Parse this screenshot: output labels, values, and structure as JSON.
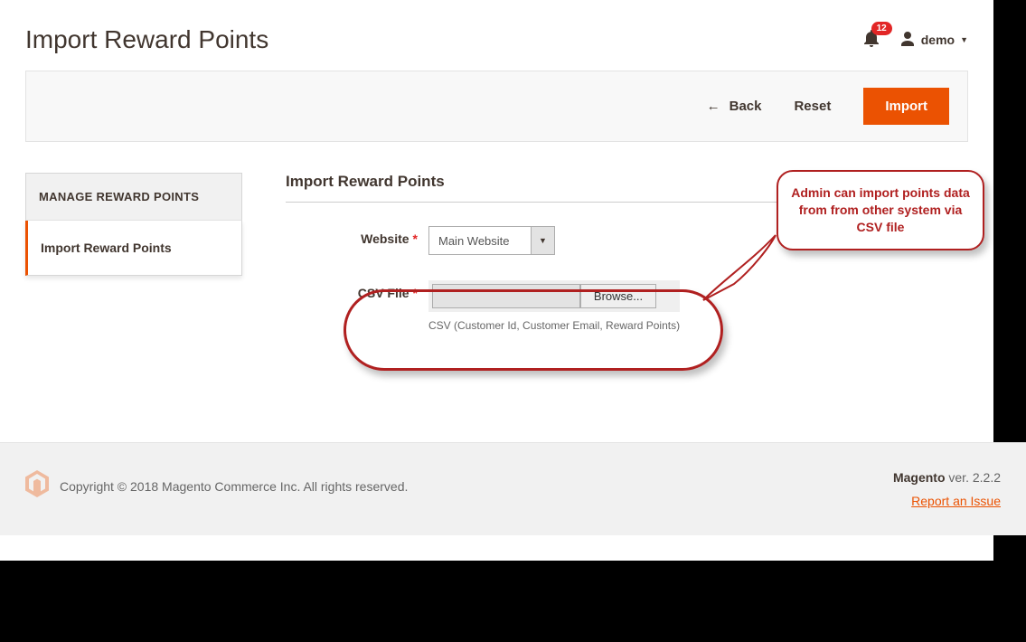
{
  "header": {
    "title": "Import Reward Points",
    "notification_count": "12",
    "username": "demo"
  },
  "toolbar": {
    "back_label": "Back",
    "reset_label": "Reset",
    "import_label": "Import"
  },
  "sidebar": {
    "heading": "MANAGE REWARD POINTS",
    "active_item": "Import Reward Points"
  },
  "form": {
    "section_title": "Import Reward Points",
    "website_label": "Website",
    "website_value": "Main Website",
    "csv_label": "CSV File",
    "browse_label": "Browse...",
    "csv_hint": "CSV (Customer Id, Customer Email, Reward Points)"
  },
  "callout": {
    "text": "Admin can import points data from from other system via CSV file"
  },
  "footer": {
    "copyright": "Copyright © 2018 Magento Commerce Inc. All rights reserved.",
    "brand": "Magento",
    "version_prefix": " ver. ",
    "version": "2.2.2",
    "report_link": "Report an Issue"
  }
}
